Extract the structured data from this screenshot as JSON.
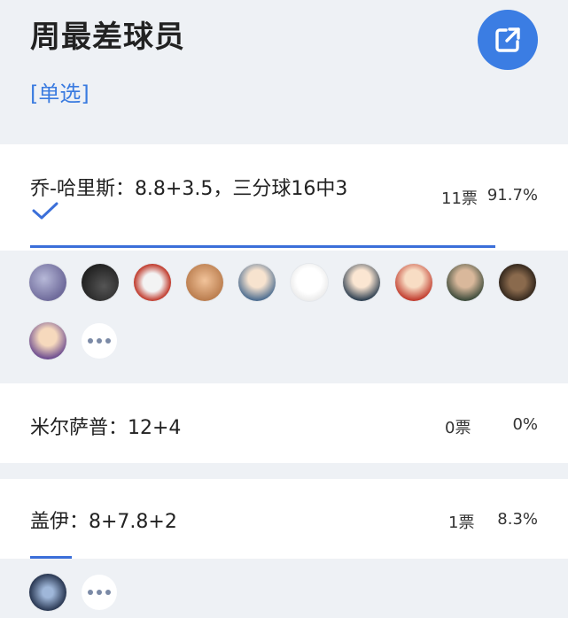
{
  "poll": {
    "title": "周最差球员",
    "mode": "[单选]"
  },
  "share": {
    "icon": "external-link-icon",
    "color": "#3b7de3"
  },
  "options": [
    {
      "label": "乔-哈里斯：8.8+3.5，三分球16中3",
      "votes": "11票",
      "percent": "91.7%",
      "percent_value": 91.7,
      "selected": true
    },
    {
      "label": "米尔萨普：12+4",
      "votes": "0票",
      "percent": "0%",
      "percent_value": 0,
      "selected": false
    },
    {
      "label": "盖伊：8+7.8+2",
      "votes": "1票",
      "percent": "8.3%",
      "percent_value": 8.3,
      "selected": false
    }
  ],
  "colors": {
    "accent": "#3b6fd9",
    "background": "#eef1f5",
    "card": "#ffffff"
  }
}
